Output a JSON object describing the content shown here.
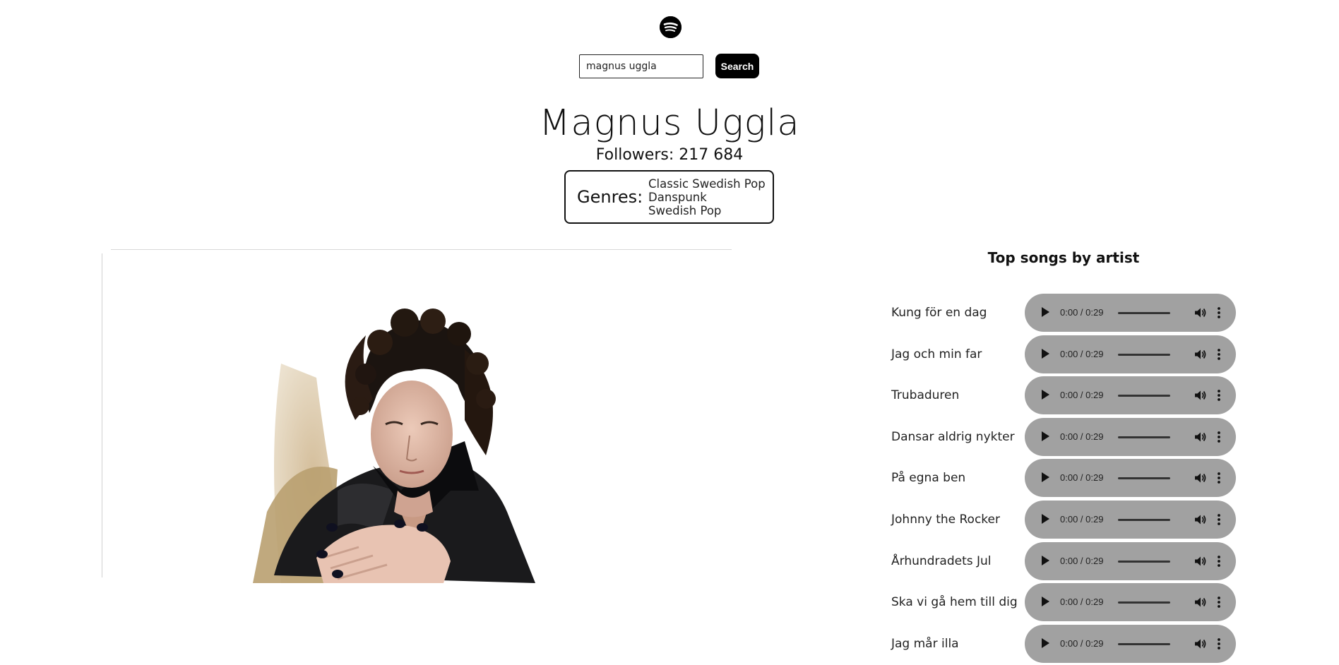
{
  "header": {
    "logo_icon": "spotify-logo-icon"
  },
  "search": {
    "value": "magnus uggla",
    "button_label": "Search"
  },
  "artist": {
    "name": "Magnus Uggla",
    "followers": "Followers: 217 684",
    "genres_label": "Genres:",
    "genres": [
      "Classic Swedish Pop",
      "Danspunk",
      "Swedish Pop"
    ]
  },
  "top_songs": {
    "title": "Top songs by artist",
    "songs": [
      {
        "title": "Kung för en dag",
        "time": "0:00 / 0:29"
      },
      {
        "title": "Jag och min far",
        "time": "0:00 / 0:29"
      },
      {
        "title": "Trubaduren",
        "time": "0:00 / 0:29"
      },
      {
        "title": "Dansar aldrig nykter",
        "time": "0:00 / 0:29"
      },
      {
        "title": "På egna ben",
        "time": "0:00 / 0:29"
      },
      {
        "title": "Johnny the Rocker",
        "time": "0:00 / 0:29"
      },
      {
        "title": "Århundradets Jul",
        "time": "0:00 / 0:29"
      },
      {
        "title": "Ska vi gå hem till dig",
        "time": "0:00 / 0:29"
      },
      {
        "title": "Jag mår illa",
        "time": "0:00 / 0:29"
      }
    ]
  },
  "colors": {
    "player_bg": "#a1a1a1",
    "button_bg": "#000000",
    "page_bg": "#ffffff"
  }
}
